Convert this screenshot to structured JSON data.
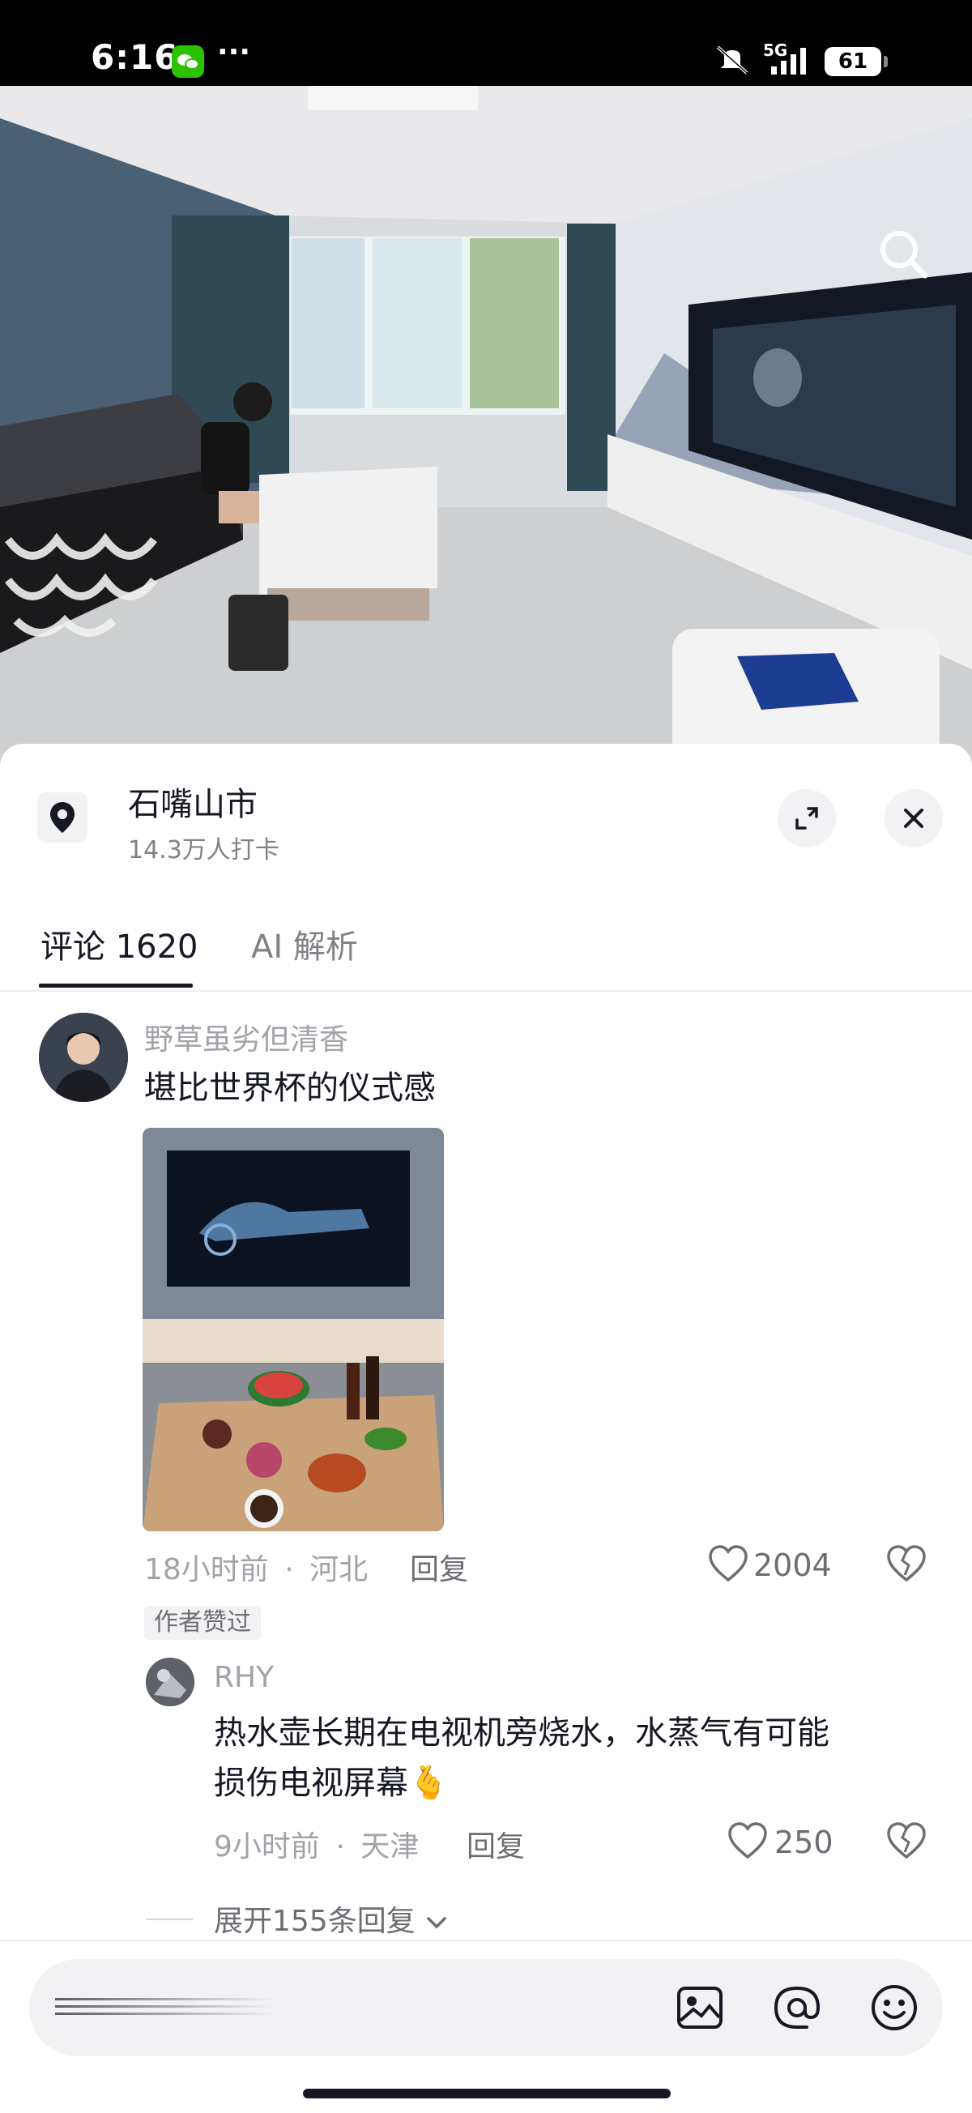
{
  "status_bar": {
    "time": "6:16",
    "network": "5G",
    "battery": "61",
    "icons": [
      "wechat-icon",
      "more-dots-icon",
      "mute-icon",
      "signal-icon",
      "battery-icon"
    ]
  },
  "location": {
    "title": "石嘴山市",
    "checkins": "14.3万人打卡"
  },
  "tabs": {
    "comments": "评论 1620",
    "ai": "AI 解析"
  },
  "comments": [
    {
      "user": "野草虽劣但清香",
      "text": "堪比世界杯的仪式感",
      "time": "18小时前",
      "region": "河北",
      "reply_label": "回复",
      "likes": "2004",
      "badge": "作者赞过"
    }
  ],
  "reply": {
    "user": "RHY",
    "text_line1": "热水壶长期在电视机旁烧水，水蒸气有可能",
    "text_line2": "损伤电视屏幕🫰",
    "time": "9小时前",
    "region": "天津",
    "reply_label": "回复",
    "likes": "250"
  },
  "expand_replies": "展开155条回复",
  "separator": "·",
  "colors": {
    "accent": "#161823",
    "muted": "#a1a3a8",
    "sheet_bg": "#ffffff"
  },
  "input_bar_icons": [
    "image-icon",
    "at-icon",
    "emoji-icon"
  ]
}
